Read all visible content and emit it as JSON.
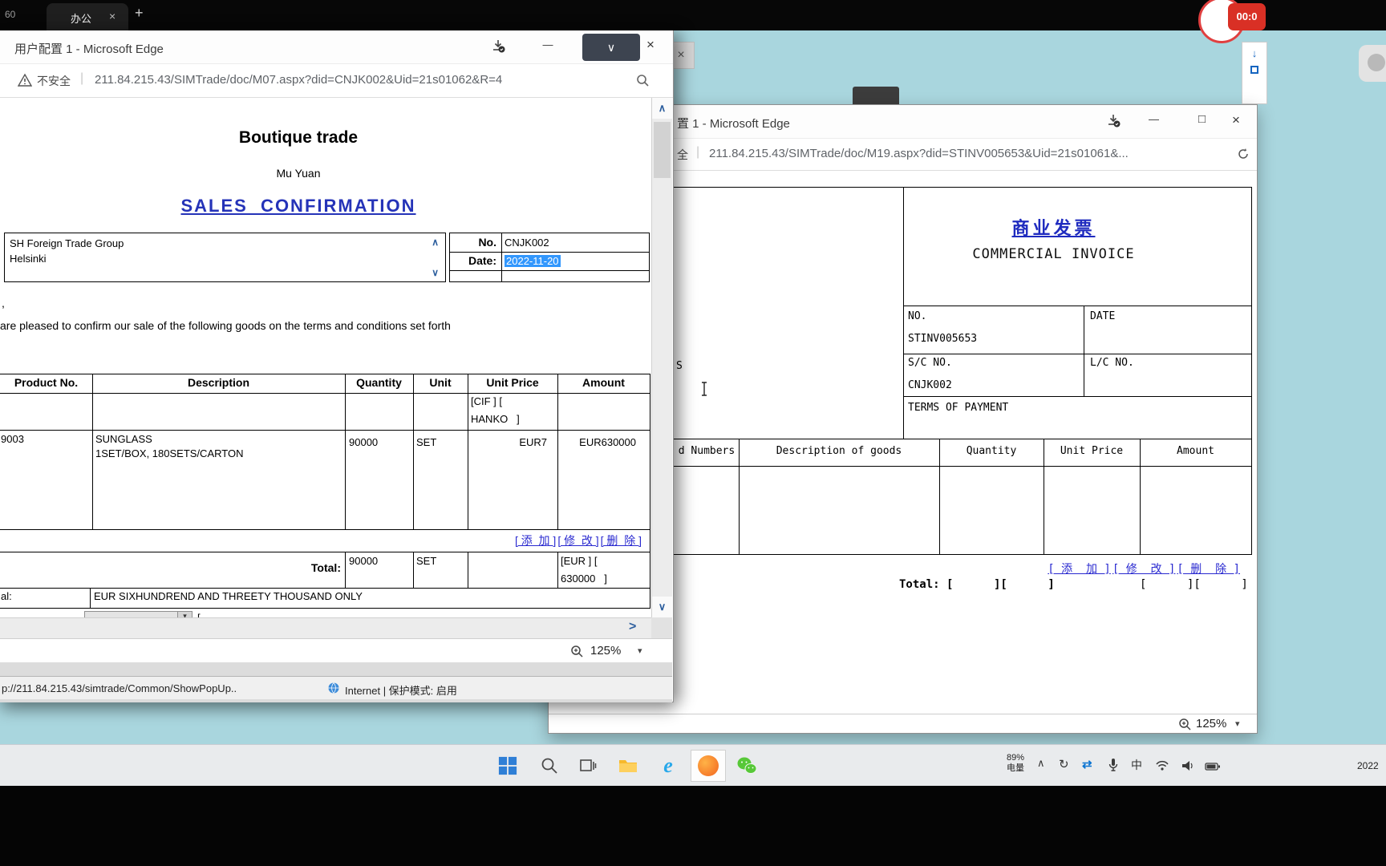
{
  "colors": {
    "desktop_teal": "#a9d6de",
    "selection_blue": "#3297fd",
    "link_blue": "#2a2ad0",
    "heading_blue": "#2533b8",
    "invoice_blue": "#1f2bbf",
    "record_red": "#d93025"
  },
  "host_tab_bar": {
    "left_fragment": "60",
    "tab_label": "办公",
    "tab_close": "×",
    "new_tab": "+"
  },
  "recording_timer": "00:0",
  "background_fragments": {
    "close_x": "×",
    "down_arrow": "↓"
  },
  "window1": {
    "title": "用户配置 1 - Microsoft Edge",
    "minimize": "—",
    "snap_chevron": "∨",
    "close": "×",
    "address": {
      "warning": "不安全",
      "divider": "|",
      "url": "211.84.215.43/SIMTrade/doc/M07.aspx?did=CNJK002&Uid=21s01062&R=4"
    },
    "doc": {
      "company": "Boutique trade",
      "subtitle": "Mu Yuan",
      "title": "SALES  CONFIRMATION",
      "seller_line1": "SH Foreign Trade Group",
      "seller_line2": "Helsinki",
      "no_label": "No.",
      "no_value": "CNJK002",
      "date_label": "Date:",
      "date_value": "2022-11-20",
      "fragment_comma": ",",
      "intro": "are pleased to confirm our sale of the following goods on the terms and conditions set forth",
      "headers": [
        "Product No.",
        "Description",
        "Quantity",
        "Unit",
        "Unit Price",
        "Amount"
      ],
      "terms_line1": "[CIF ] [",
      "terms_line2": "HANKO   ]",
      "row": {
        "product_no": "9003",
        "desc1": "SUNGLASS",
        "desc2": "1SET/BOX, 180SETS/CARTON",
        "qty": "90000",
        "unit": "SET",
        "unit_price": "EUR7",
        "amount": "EUR630000"
      },
      "action_add": "[ 添  加 ]",
      "action_modify": "[ 修  改 ]",
      "action_delete": "[ 删  除 ]",
      "total_label": "Total:",
      "total_qty": "90000",
      "total_unit": "SET",
      "total_amount1": "[EUR ] [",
      "total_amount2": "630000   ]",
      "words_label": "al:",
      "words_value": "EUR SIXHUNDREND AND THREETY THOUSAND ONLY",
      "fragment_bracket": "["
    },
    "scroll_up": "∧",
    "scroll_down": "∨",
    "hscroll_arrow": ">",
    "zoom_value": "125%",
    "zoom_caret": "▾",
    "status_link": "p://211.84.215.43/simtrade/Common/ShowPopUp..",
    "status_zone": "Internet | 保护模式: 启用"
  },
  "window2": {
    "title": "置 1 - Microsoft Edge",
    "minimize": "—",
    "maximize": "□",
    "close": "×",
    "address": {
      "warning_fragment": "全",
      "divider": "|",
      "url": "211.84.215.43/SIMTrade/doc/M19.aspx?did=STINV005653&Uid=21s01061&..."
    },
    "doc": {
      "title_cn": "商业发票",
      "title_en": "COMMERCIAL INVOICE",
      "no_label": "NO.",
      "no_value": "STINV005653",
      "date_label": "DATE",
      "sc_label": "S/C NO.",
      "sc_value": "CNJK002",
      "lc_label": "L/C NO.",
      "terms_label": "TERMS OF PAYMENT",
      "fragment_s": "S",
      "goods_headers": [
        "d Numbers",
        "Description of goods",
        "Quantity",
        "Unit Price",
        "Amount"
      ],
      "action_add": "[ 添  加 ]",
      "action_modify": "[ 修  改 ]",
      "action_delete": "[ 删  除 ]",
      "total_left": "Total: [      ][      ]",
      "total_right": "[      ][      ]"
    },
    "zoom_value": "125%",
    "zoom_caret": "▾"
  },
  "taskbar": {
    "battery_percent": "89%",
    "battery_label": "电量",
    "tray_chevron": "∧",
    "tray_refresh": "↻",
    "tray_sync": "⇄",
    "ime": "中",
    "ie_label": "e",
    "clock": "2022"
  }
}
